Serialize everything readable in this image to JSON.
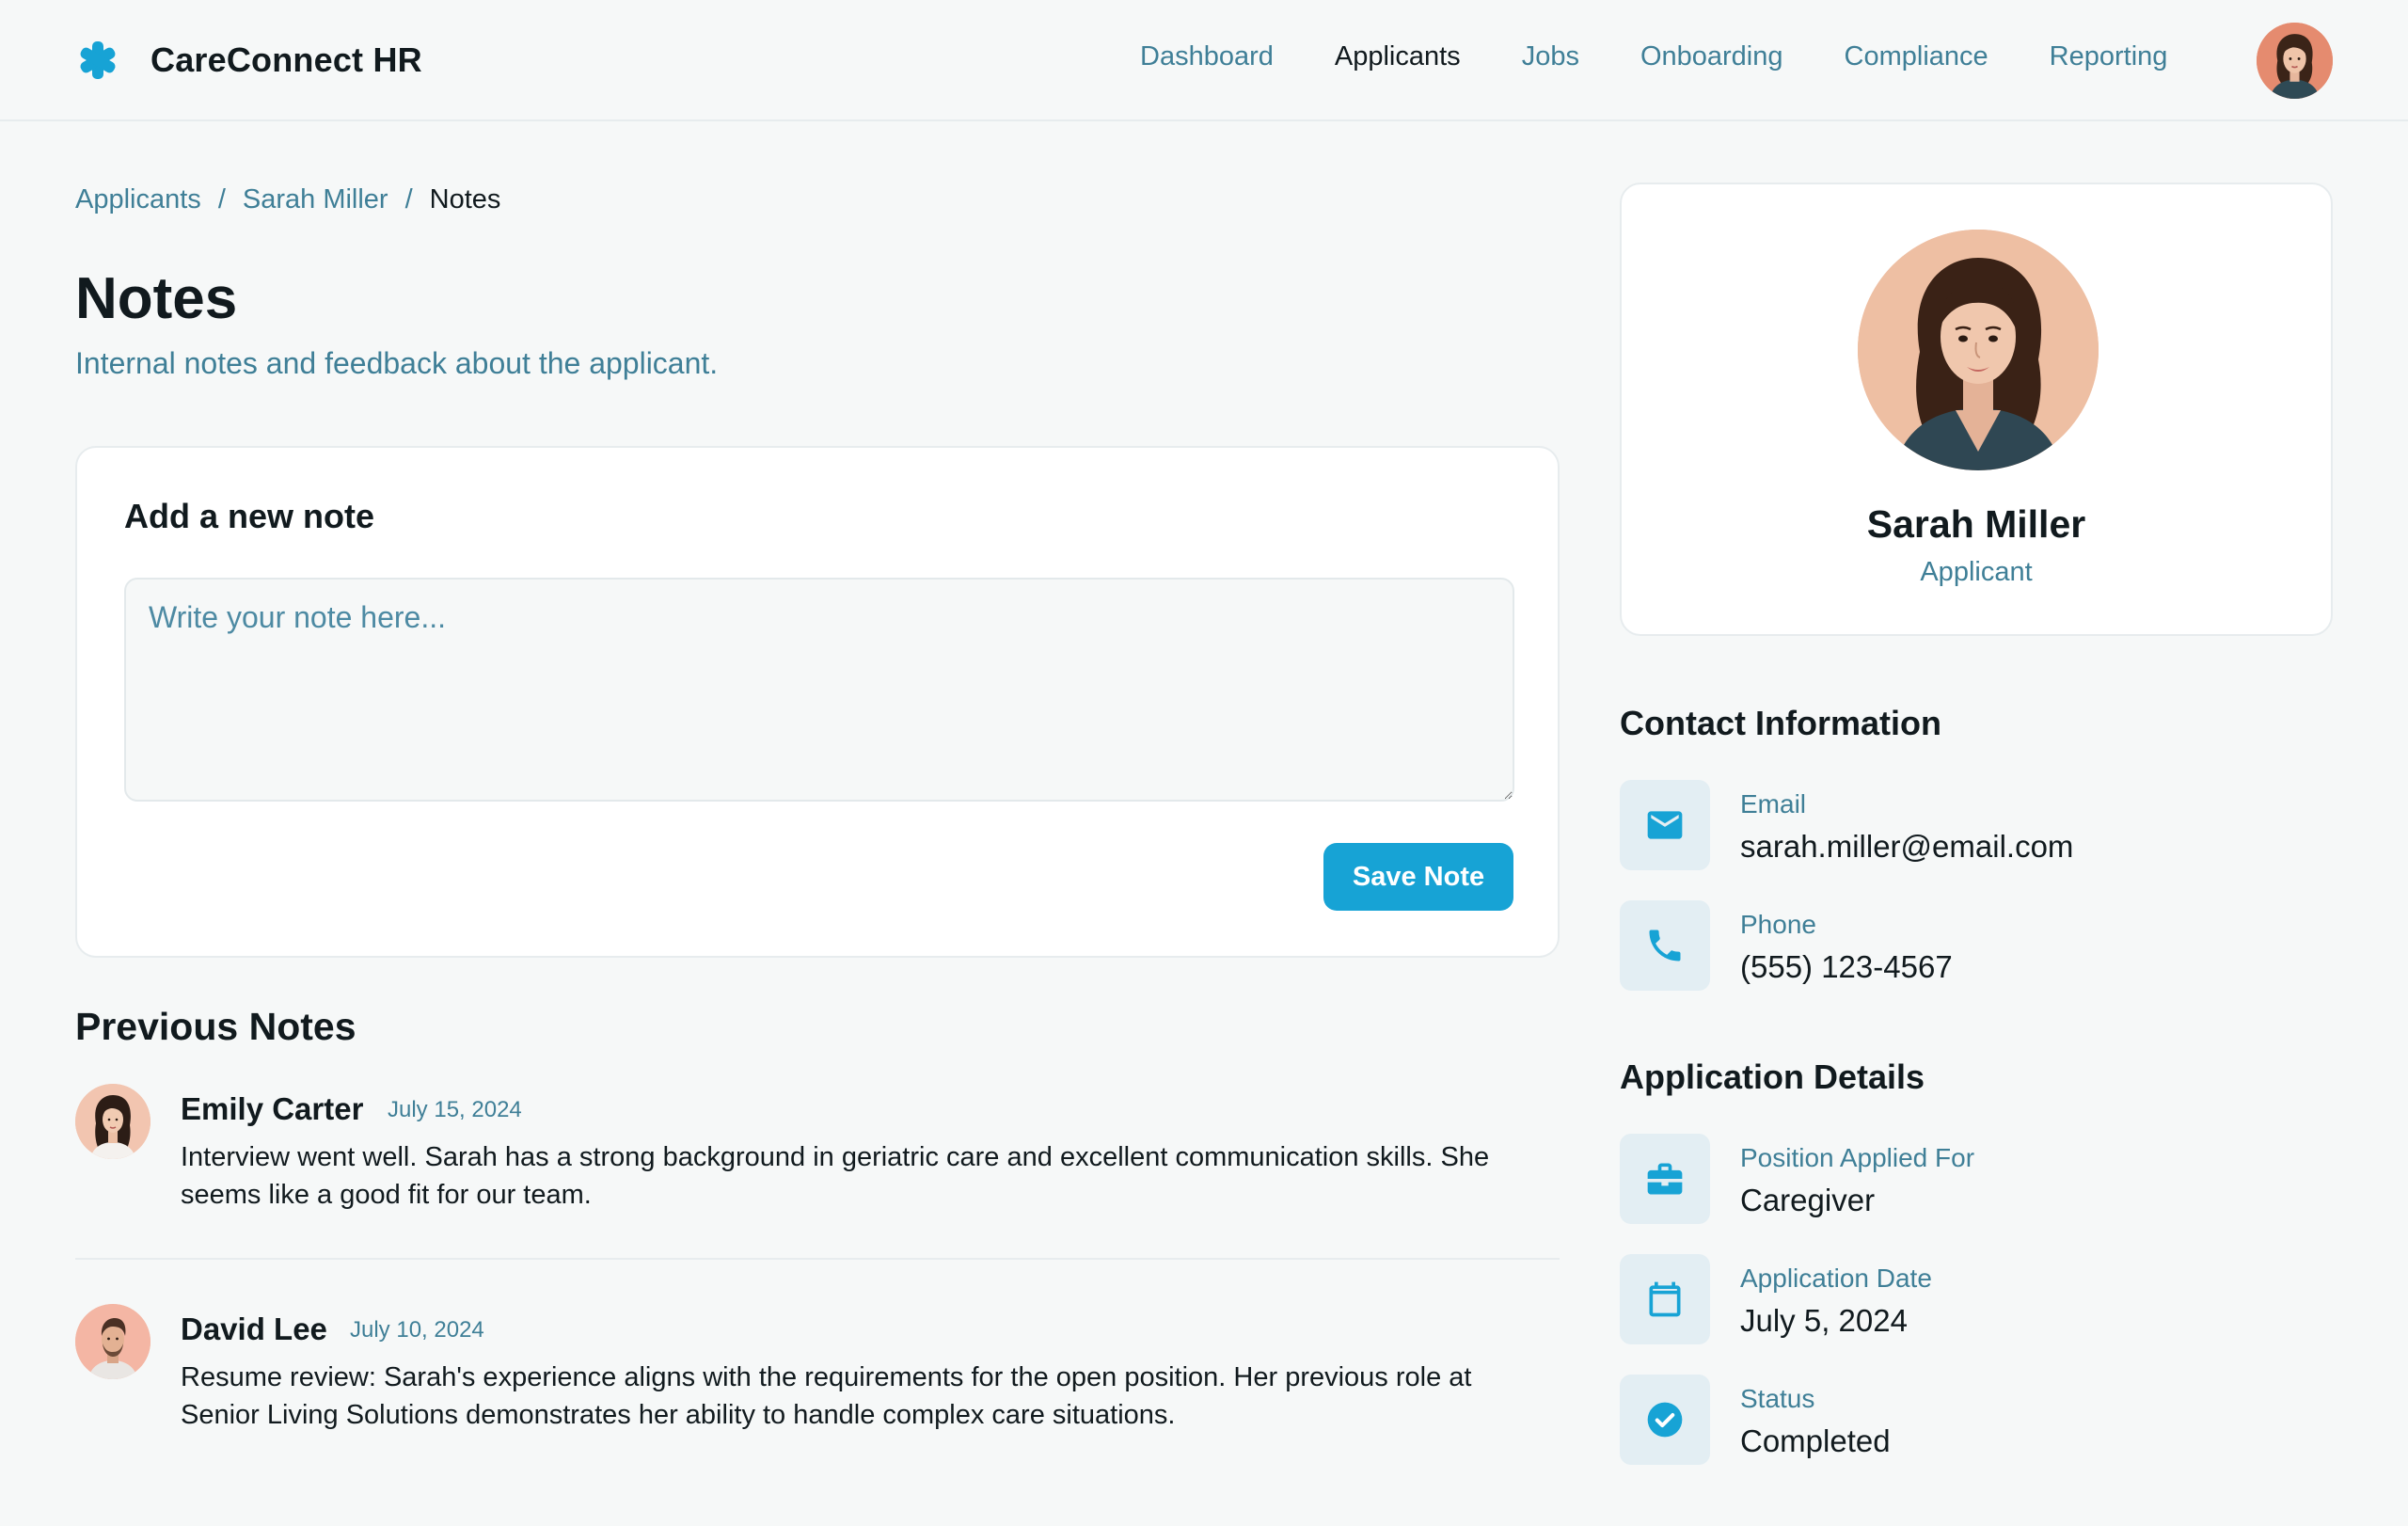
{
  "brand": {
    "name": "CareConnect HR",
    "accent": "#17a3d5"
  },
  "nav": {
    "items": [
      {
        "label": "Dashboard",
        "active": false
      },
      {
        "label": "Applicants",
        "active": true
      },
      {
        "label": "Jobs",
        "active": false
      },
      {
        "label": "Onboarding",
        "active": false
      },
      {
        "label": "Compliance",
        "active": false
      },
      {
        "label": "Reporting",
        "active": false
      }
    ]
  },
  "breadcrumb": {
    "items": [
      "Applicants",
      "Sarah Miller"
    ],
    "current": "Notes",
    "separator": "/"
  },
  "page": {
    "title": "Notes",
    "subtitle": "Internal notes and feedback about the applicant."
  },
  "new_note": {
    "title": "Add a new note",
    "placeholder": "Write your note here...",
    "value": "",
    "save_label": "Save Note"
  },
  "previous_notes": {
    "title": "Previous Notes",
    "items": [
      {
        "author": "Emily Carter",
        "date": "July 15, 2024",
        "text": "Interview went well. Sarah has a strong background in geriatric care and excellent communication skills. She seems like a good fit for our team."
      },
      {
        "author": "David Lee",
        "date": "July 10, 2024",
        "text": "Resume review: Sarah's experience aligns with the requirements for the open position. Her previous role at Senior Living Solutions demonstrates her ability to handle complex care situations."
      }
    ]
  },
  "profile": {
    "name": "Sarah Miller",
    "role": "Applicant"
  },
  "contact": {
    "title": "Contact Information",
    "email": {
      "label": "Email",
      "value": "sarah.miller@email.com",
      "icon": "mail-icon"
    },
    "phone": {
      "label": "Phone",
      "value": "(555) 123-4567",
      "icon": "phone-icon"
    }
  },
  "application": {
    "title": "Application Details",
    "position": {
      "label": "Position Applied For",
      "value": "Caregiver",
      "icon": "briefcase-icon"
    },
    "date": {
      "label": "Application Date",
      "value": "July 5, 2024",
      "icon": "calendar-icon"
    },
    "status": {
      "label": "Status",
      "value": "Completed",
      "icon": "check-circle-icon"
    }
  }
}
